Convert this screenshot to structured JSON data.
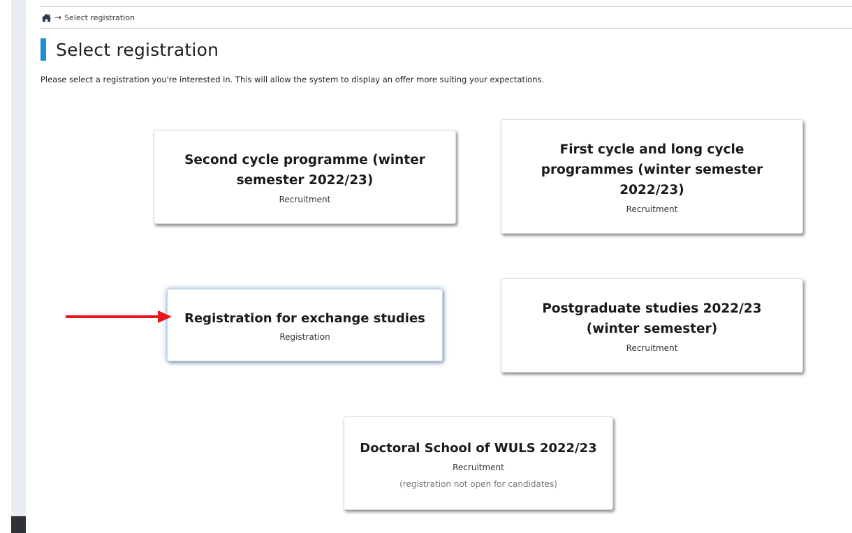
{
  "breadcrumb": {
    "home_icon": "home-icon",
    "separator": "→",
    "current": "Select registration"
  },
  "page": {
    "title": "Select registration",
    "intro": "Please select a registration you're interested in. This will allow the system to display an offer more suiting your expectations."
  },
  "cards": [
    {
      "title": "Second cycle programme (winter semester 2022/23)",
      "type": "Recruitment"
    },
    {
      "title": "First cycle and long cycle programmes (winter semester 2022/23)",
      "type": "Recruitment"
    },
    {
      "title": "Registration for exchange studies",
      "type": "Registration"
    },
    {
      "title": "Postgraduate studies 2022/23 (winter semester)",
      "type": "Recruitment"
    },
    {
      "title": "Doctoral School of WULS 2022/23",
      "type": "Recruitment",
      "note": "(registration not open for candidates)"
    }
  ],
  "colors": {
    "accent": "#1d8fd3",
    "annotation_arrow": "#e8161b"
  }
}
